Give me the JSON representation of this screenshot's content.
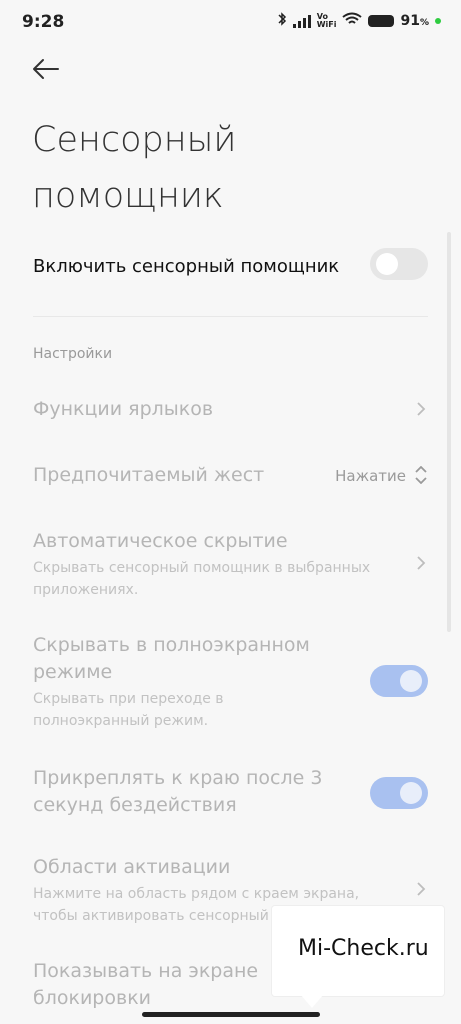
{
  "status_bar": {
    "time": "9:28",
    "network_badge": "Vo\nWiFi",
    "battery": "91",
    "battery_unit": "%",
    "bluetooth_icon": "bluetooth-icon",
    "wifi_icon": "wifi-icon"
  },
  "header": {
    "title": "Сенсорный помощник"
  },
  "main_toggle": {
    "label": "Включить сенсорный помощник",
    "enabled": false
  },
  "section": {
    "label": "Настройки"
  },
  "items": [
    {
      "title": "Функции ярлыков",
      "subtitle": "",
      "control": "chevron"
    },
    {
      "title": "Предпочитаемый жест",
      "subtitle": "",
      "control": "select",
      "value": "Нажатие"
    },
    {
      "title": "Автоматическое скрытие",
      "subtitle": "Скрывать сенсорный помощник в выбранных приложениях.",
      "control": "chevron"
    },
    {
      "title": "Скрывать в полноэкранном режиме",
      "subtitle": "Скрывать при переходе в полноэкранный режим.",
      "control": "toggle",
      "enabled": true
    },
    {
      "title": "Прикреплять к краю после 3 секунд бездействия",
      "subtitle": "",
      "control": "toggle",
      "enabled": true
    },
    {
      "title": "Области активации",
      "subtitle": "Нажмите на область рядом с краем экрана, чтобы активировать сенсорный",
      "control": "chevron"
    },
    {
      "title": "Показывать на экране блокировки",
      "subtitle": "",
      "control": "toggle",
      "enabled": false
    }
  ],
  "watermark": {
    "text": "Mi-Check.ru"
  },
  "colors": {
    "accent_toggle_on": "#a9c1f0",
    "toggle_off": "#e6e6e6",
    "disabled_text": "#b5b5b5"
  }
}
